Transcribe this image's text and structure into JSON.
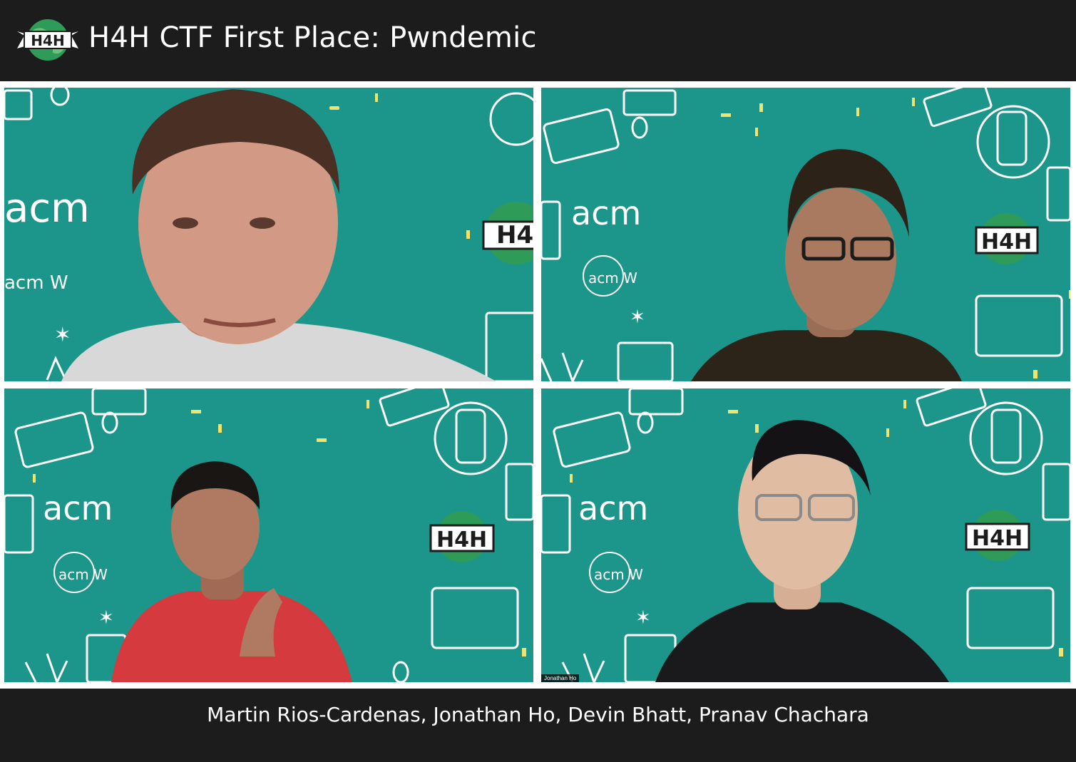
{
  "header": {
    "logo_text": "H4H",
    "title": "H4H CTF First Place: Pwndemic"
  },
  "participants": [
    {
      "tile_logo": "H4",
      "acm": "acm",
      "acmw": "acm W"
    },
    {
      "tile_logo": "H4H",
      "acm": "acm",
      "acmw": "acm W"
    },
    {
      "tile_logo": "H4H",
      "acm": "acm",
      "acmw": "acm W"
    },
    {
      "tile_logo": "H4H",
      "acm": "acm",
      "acmw": "acm W",
      "name_tag": "Jonathan Ho"
    }
  ],
  "footer": {
    "names": "Martin Rios-Cardenas, Jonathan Ho, Devin Bhatt, Pranav Chachara"
  },
  "colors": {
    "bar": "#1c1c1c",
    "tile_bg": "#1c968a",
    "accent_yellow": "#f2e36b"
  }
}
